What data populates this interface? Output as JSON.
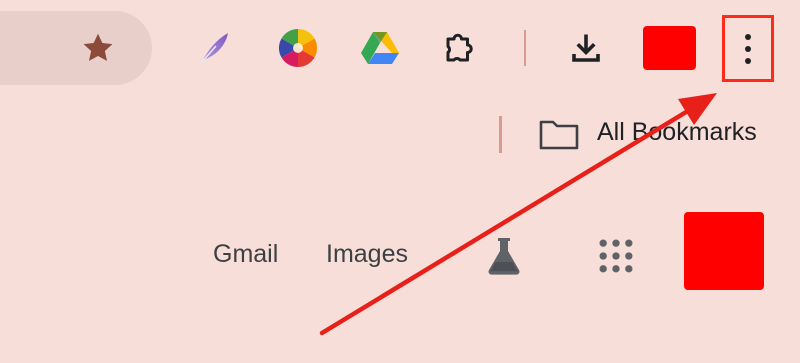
{
  "toolbar": {
    "icons": {
      "bookmark_star": "star-icon",
      "extension_1": "quill-icon",
      "extension_2": "color-wheel-icon",
      "extension_3": "google-drive-icon",
      "extensions": "puzzle-icon",
      "downloads": "download-icon",
      "menu": "kebab-menu-icon"
    },
    "profile_color": "#ff0000",
    "menu_highlight_color": "#ff2a1a"
  },
  "bookmarks_bar": {
    "folder_icon": "folder-icon",
    "label": "All Bookmarks"
  },
  "google_header": {
    "gmail_label": "Gmail",
    "images_label": "Images",
    "labs_icon": "flask-icon",
    "apps_icon": "apps-grid-icon",
    "avatar_color": "#ff0000"
  },
  "annotation": {
    "type": "arrow",
    "color": "#e8201a",
    "points_to": "menu-button"
  },
  "colors": {
    "background": "#f8ded8",
    "omnibox": "#e9cfc9",
    "star": "#8b4a3a"
  }
}
